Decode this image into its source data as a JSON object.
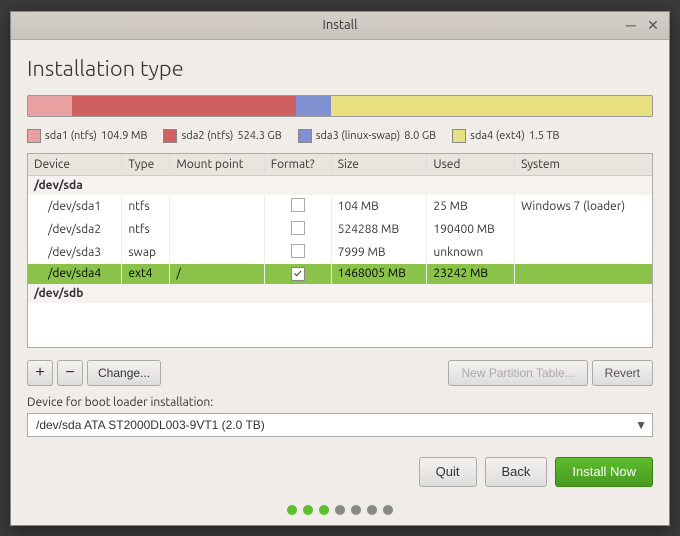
{
  "window": {
    "title": "Install",
    "minimize_label": "─",
    "close_label": "✕"
  },
  "page": {
    "title": "Installation type"
  },
  "disk_bar": {
    "segments": [
      {
        "id": "sda1",
        "class": "disk-segment-sda1"
      },
      {
        "id": "sda2",
        "class": "disk-segment-sda2"
      },
      {
        "id": "sda3",
        "class": "disk-segment-sda3"
      },
      {
        "id": "sda4",
        "class": "disk-segment-sda4"
      }
    ]
  },
  "legend": [
    {
      "label": "sda1 (ntfs)",
      "color": "#e8a0a0",
      "size": "104.9 MB"
    },
    {
      "label": "sda2 (ntfs)",
      "color": "#d06060",
      "size": "524.3 GB"
    },
    {
      "label": "sda3 (linux-swap)",
      "color": "#8090d0",
      "size": "8.0 GB"
    },
    {
      "label": "sda4 (ext4)",
      "color": "#e8e080",
      "size": "1.5 TB"
    }
  ],
  "table": {
    "headers": [
      "Device",
      "Type",
      "Mount point",
      "Format?",
      "Size",
      "Used",
      "System"
    ],
    "groups": [
      {
        "group_label": "/dev/sda",
        "rows": [
          {
            "device": "/dev/sda1",
            "type": "ntfs",
            "mount": "",
            "format": false,
            "size": "104 MB",
            "used": "25 MB",
            "system": "Windows 7 (loader)",
            "selected": false
          },
          {
            "device": "/dev/sda2",
            "type": "ntfs",
            "mount": "",
            "format": false,
            "size": "524288 MB",
            "used": "190400 MB",
            "system": "",
            "selected": false
          },
          {
            "device": "/dev/sda3",
            "type": "swap",
            "mount": "",
            "format": false,
            "size": "7999 MB",
            "used": "unknown",
            "system": "",
            "selected": false
          },
          {
            "device": "/dev/sda4",
            "type": "ext4",
            "mount": "/",
            "format": true,
            "size": "1468005 MB",
            "used": "23242 MB",
            "system": "",
            "selected": true
          }
        ]
      },
      {
        "group_label": "/dev/sdb",
        "rows": []
      }
    ]
  },
  "toolbar": {
    "add_label": "+",
    "remove_label": "−",
    "change_label": "Change...",
    "new_partition_table_label": "New Partition Table...",
    "revert_label": "Revert"
  },
  "bootloader": {
    "label": "Device for boot loader installation:",
    "value": "/dev/sda  ATA ST2000DL003-9VT1 (2.0 TB)"
  },
  "footer": {
    "quit_label": "Quit",
    "back_label": "Back",
    "install_label": "Install Now"
  },
  "steps": {
    "total": 7,
    "active": 3
  }
}
